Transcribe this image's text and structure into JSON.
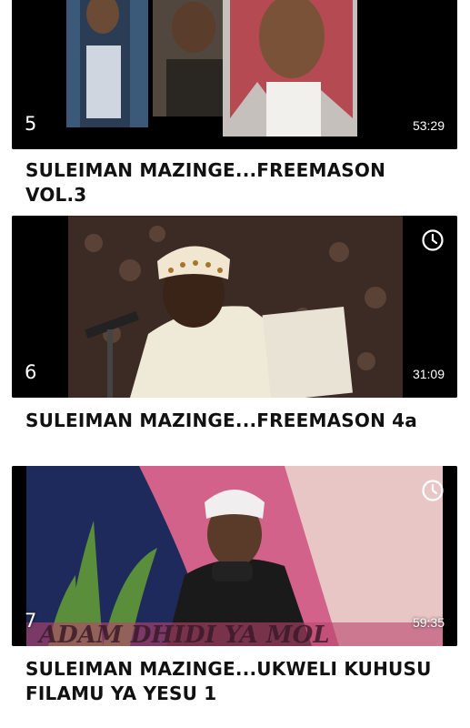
{
  "colors": {
    "thumbnail_bg": "#000000",
    "badge_text": "#ffffff",
    "title_text": "#111111"
  },
  "videos": [
    {
      "index": "5",
      "duration": "53:29",
      "title": "SULEIMAN MAZINGE...FREEMASON VOL.3",
      "show_clock_icon": false
    },
    {
      "index": "6",
      "duration": "31:09",
      "title": "SULEIMAN MAZINGE...FREEMASON 4a",
      "show_clock_icon": true,
      "clock_icon": "clock-icon"
    },
    {
      "index": "7",
      "duration": "59:35",
      "title": "SULEIMAN MAZINGE...UKWELI KUHUSU FILAMU YA YESU 1",
      "show_clock_icon": true,
      "clock_icon": "clock-icon",
      "watermark": "ADAM DHIDI YA MOL"
    }
  ]
}
